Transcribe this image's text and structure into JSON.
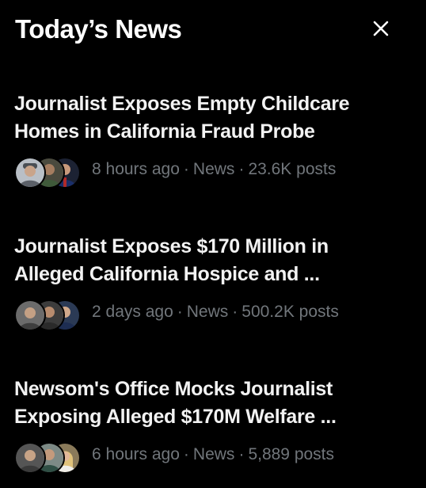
{
  "panel": {
    "title": "Today’s News",
    "close_icon": "close-icon"
  },
  "items": [
    {
      "headline_line1": "Journalist Exposes Empty Childcare",
      "headline_line2": "Homes in California Fraud Probe",
      "time": "8 hours ago",
      "category": "News",
      "posts": "23.6K posts",
      "separator": "·",
      "avatars": [
        "avatar-person-icon",
        "avatar-person-icon",
        "avatar-person-icon"
      ]
    },
    {
      "headline_line1": "Journalist Exposes $170 Million in",
      "headline_line2": "Alleged California Hospice and ...",
      "time": "2 days ago",
      "category": "News",
      "posts": "500.2K posts",
      "separator": "·",
      "avatars": [
        "avatar-person-icon",
        "avatar-person-icon",
        "avatar-person-icon"
      ]
    },
    {
      "headline_line1": "Newsom's Office Mocks Journalist",
      "headline_line2": "Exposing Alleged $170M Welfare ...",
      "time": "6 hours ago",
      "category": "News",
      "posts": "5,889 posts",
      "separator": "·",
      "avatars": [
        "avatar-person-icon",
        "avatar-person-icon",
        "avatar-person-icon"
      ]
    }
  ],
  "colors": {
    "background": "#000000",
    "headline": "#f2f2f2",
    "meta": "#71767b"
  }
}
